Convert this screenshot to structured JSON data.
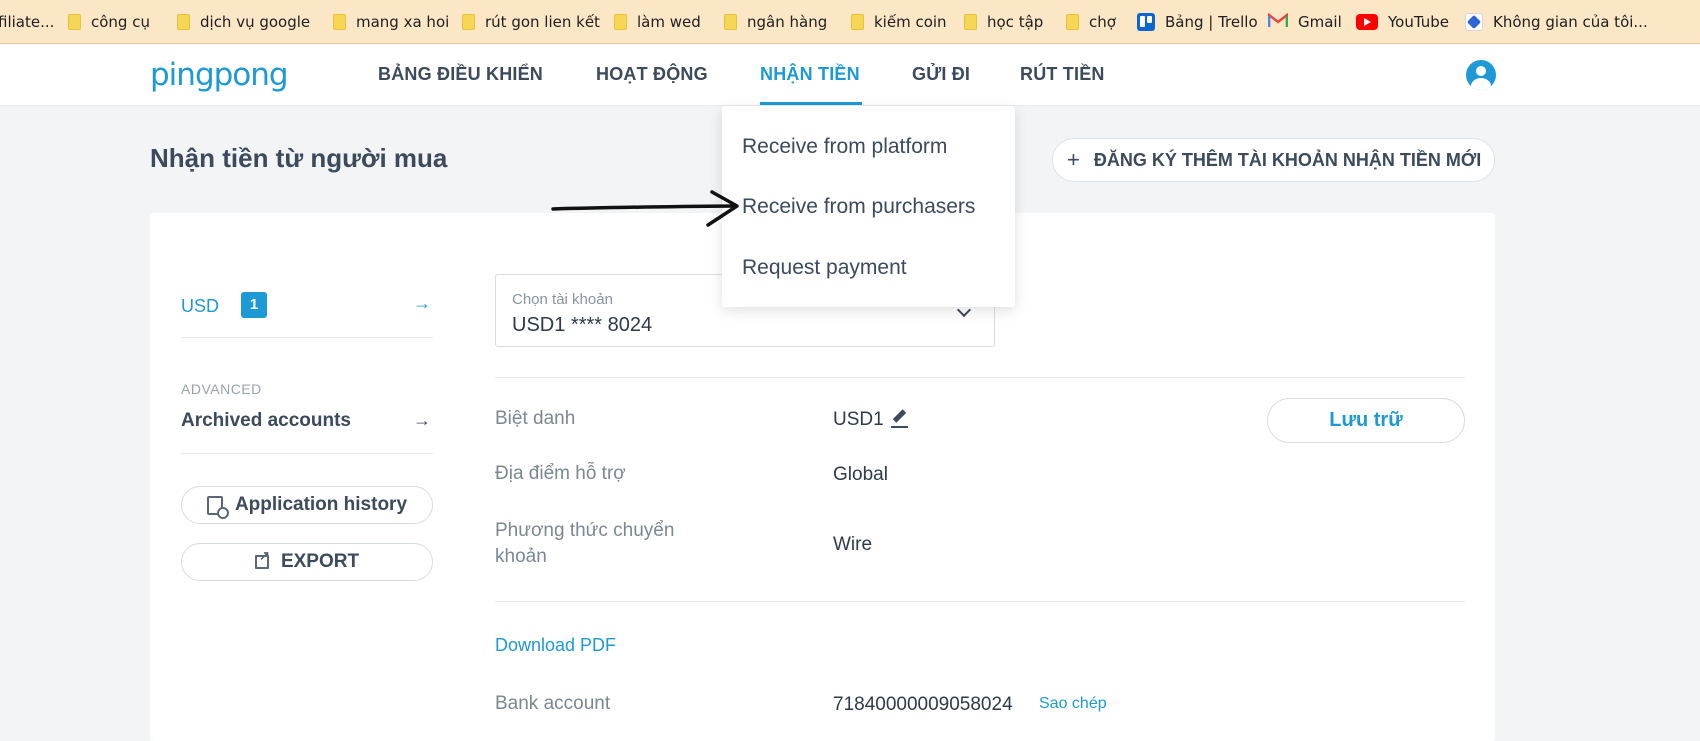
{
  "bookmarks": [
    {
      "label": "filiate...",
      "icon": "none"
    },
    {
      "label": "công cụ",
      "icon": "folder-icon"
    },
    {
      "label": "dịch vụ google",
      "icon": "folder-icon"
    },
    {
      "label": "mang xa hoi",
      "icon": "folder-icon"
    },
    {
      "label": "rút gon lien kết",
      "icon": "folder-icon"
    },
    {
      "label": "làm wed",
      "icon": "folder-icon"
    },
    {
      "label": "ngân hàng",
      "icon": "folder-icon"
    },
    {
      "label": "kiếm coin",
      "icon": "folder-icon"
    },
    {
      "label": "học tập",
      "icon": "folder-icon"
    },
    {
      "label": "chợ",
      "icon": "folder-icon"
    },
    {
      "label": "Bảng | Trello",
      "icon": "trello-icon"
    },
    {
      "label": "Gmail",
      "icon": "gmail-icon"
    },
    {
      "label": "YouTube",
      "icon": "youtube-icon"
    },
    {
      "label": "Không gian của tôi...",
      "icon": "app-icon"
    }
  ],
  "header": {
    "logo": "pingpong",
    "nav": [
      {
        "label": "BẢNG ĐIỀU KHIỂN"
      },
      {
        "label": "HOẠT ĐỘNG"
      },
      {
        "label": "NHẬN TIỀN",
        "active": true
      },
      {
        "label": "GỬI ĐI"
      },
      {
        "label": "RÚT TIỀN"
      }
    ],
    "avatar_icon": "user-avatar-icon"
  },
  "page": {
    "title": "Nhận tiền từ người mua",
    "add_account_button": "ĐĂNG KÝ THÊM TÀI KHOẢN NHẬN TIỀN MỚI"
  },
  "dropdown": {
    "items": [
      "Receive from platform",
      "Receive from purchasers",
      "Request payment"
    ]
  },
  "sidebar": {
    "currency": "USD",
    "currency_count": "1",
    "advanced_label": "ADVANCED",
    "archived_label": "Archived accounts",
    "application_history": "Application history",
    "export": "EXPORT"
  },
  "account": {
    "select_label": "Chọn tài khoản",
    "select_value": "USD1 **** 8024",
    "nickname_label": "Biệt danh",
    "nickname_value": "USD1",
    "save_button": "Lưu trữ",
    "location_label": "Địa điểm hỗ trợ",
    "location_value": "Global",
    "method_label_line1": "Phương thức chuyển",
    "method_label_line2": "khoản",
    "method_value": "Wire",
    "download_pdf": "Download PDF",
    "bank_account_label": "Bank account",
    "bank_account_value": "71840000009058024",
    "copy_link": "Sao chép"
  },
  "colors": {
    "accent": "#1d9ad6",
    "bookmark_bar": "#fbe6c5",
    "page_bg": "#f2f4f6"
  }
}
